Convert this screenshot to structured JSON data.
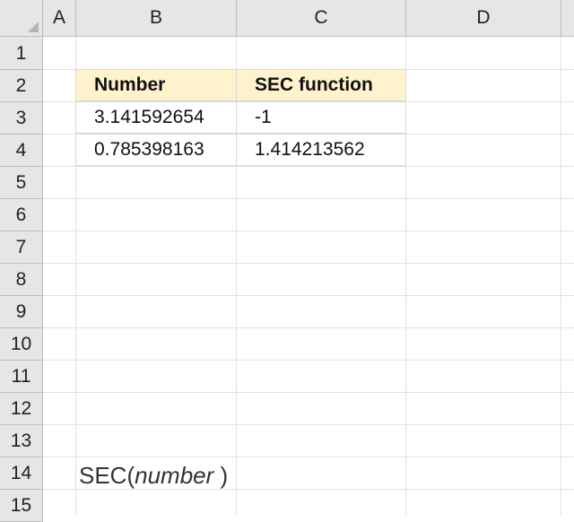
{
  "columns": [
    "A",
    "B",
    "C",
    "D"
  ],
  "rows": [
    "1",
    "2",
    "3",
    "4",
    "5",
    "6",
    "7",
    "8",
    "9",
    "10",
    "11",
    "12",
    "13",
    "14",
    "15"
  ],
  "table": {
    "headers": [
      "Number",
      "SEC function"
    ],
    "rows": [
      [
        "3.141592654",
        "-1"
      ],
      [
        "0.785398163",
        "1.414213562"
      ]
    ],
    "header_color": "#fff2cc"
  },
  "formula": {
    "name": "SEC(",
    "arg": "number",
    "close": " )"
  }
}
